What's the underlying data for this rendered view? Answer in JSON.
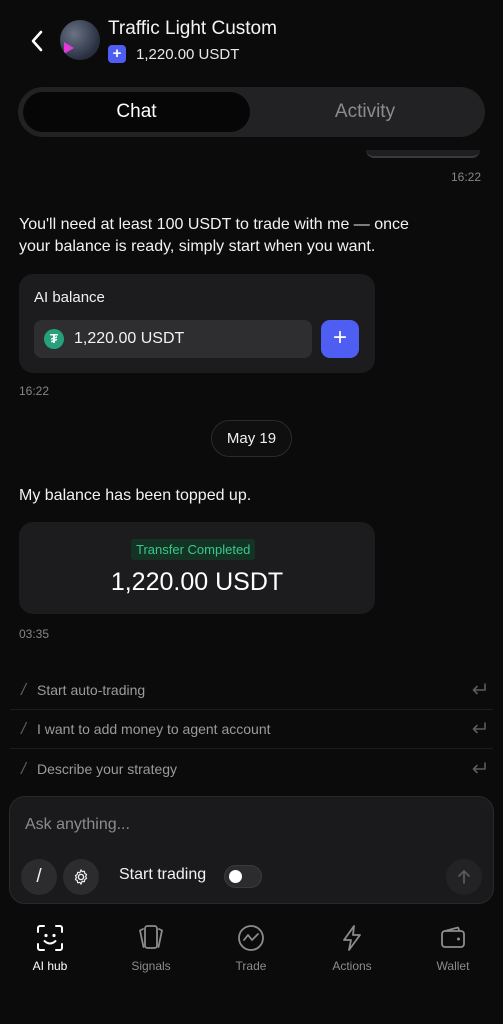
{
  "header": {
    "title": "Traffic Light Custom",
    "balance": "1,220.00 USDT",
    "plus_label": "+"
  },
  "tabs": [
    {
      "label": "Chat",
      "active": true
    },
    {
      "label": "Activity",
      "active": false
    }
  ],
  "messages": {
    "time_1": "16:22",
    "agent_text": "You'll need at least 100 USDT to trade with me — once your balance is ready, simply start when you want.",
    "ai_balance_label": "AI balance",
    "ai_balance_value": "1,220.00 USDT",
    "add_label": "+",
    "time_2": "16:22",
    "date_separator": "May 19",
    "user_text": "My balance has been topped up.",
    "transfer_status": "Transfer Completed",
    "transfer_amount": "1,220.00 USDT",
    "time_3": "03:35"
  },
  "suggestions": [
    "Start auto-trading",
    "I want to add money to agent account",
    "Describe your strategy"
  ],
  "composer": {
    "placeholder": "Ask anything...",
    "slash_label": "/",
    "start_trading_label": "Start trading",
    "toggle_on": false
  },
  "nav": [
    {
      "label": "AI hub",
      "icon": "smiley-icon",
      "active": true
    },
    {
      "label": "Signals",
      "icon": "cards-icon",
      "active": false
    },
    {
      "label": "Trade",
      "icon": "chart-circle-icon",
      "active": false
    },
    {
      "label": "Actions",
      "icon": "lightning-icon",
      "active": false
    },
    {
      "label": "Wallet",
      "icon": "wallet-icon",
      "active": false
    }
  ],
  "colors": {
    "accent": "#4e5df2",
    "success": "#38c98a",
    "background": "#0b0b0c",
    "card": "#1c1c1e"
  }
}
